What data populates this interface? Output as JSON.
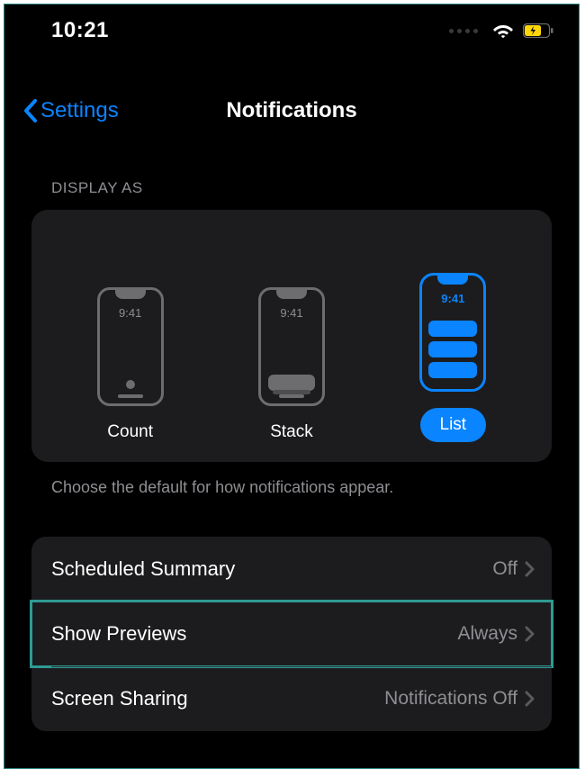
{
  "statusbar": {
    "time": "10:21"
  },
  "nav": {
    "back_label": "Settings",
    "title": "Notifications"
  },
  "display_as": {
    "header": "DISPLAY AS",
    "phone_time": "9:41",
    "options": [
      {
        "label": "Count",
        "selected": false
      },
      {
        "label": "Stack",
        "selected": false
      },
      {
        "label": "List",
        "selected": true
      }
    ],
    "footer": "Choose the default for how notifications appear."
  },
  "rows": [
    {
      "label": "Scheduled Summary",
      "value": "Off"
    },
    {
      "label": "Show Previews",
      "value": "Always"
    },
    {
      "label": "Screen Sharing",
      "value": "Notifications Off"
    }
  ],
  "colors": {
    "accent": "#0a84ff",
    "highlight": "#2e9b93"
  }
}
